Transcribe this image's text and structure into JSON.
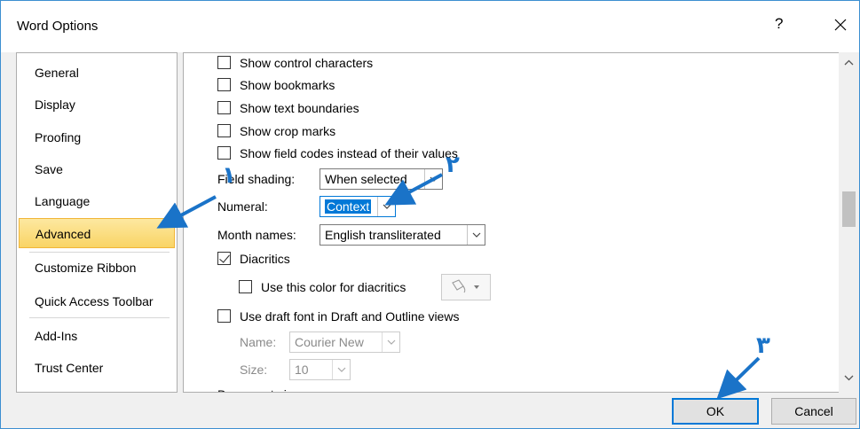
{
  "dialog": {
    "title": "Word Options",
    "help": "?",
    "ok_label": "OK",
    "cancel_label": "Cancel"
  },
  "sidebar": {
    "items": [
      {
        "label": "General"
      },
      {
        "label": "Display"
      },
      {
        "label": "Proofing"
      },
      {
        "label": "Save"
      },
      {
        "label": "Language"
      },
      {
        "label": "Advanced",
        "active": true
      },
      {
        "label": "Customize Ribbon"
      },
      {
        "label": "Quick Access Toolbar"
      },
      {
        "label": "Add-Ins"
      },
      {
        "label": "Trust Center"
      }
    ]
  },
  "content": {
    "checkboxes": [
      {
        "label": "Show control characters",
        "checked": false
      },
      {
        "label": "Show bookmarks",
        "checked": false
      },
      {
        "label": "Show text boundaries",
        "checked": false
      },
      {
        "label": "Show crop marks",
        "checked": false
      },
      {
        "label": "Show field codes instead of their values",
        "checked": false
      }
    ],
    "field_shading": {
      "label": "Field shading:",
      "value": "When selected"
    },
    "numeral": {
      "label": "Numeral:",
      "value": "Context"
    },
    "month_names": {
      "label": "Month names:",
      "value": "English transliterated"
    },
    "diacritics": {
      "label": "Diacritics",
      "checked": true
    },
    "diacritics_color": {
      "label": "Use this color for diacritics",
      "checked": false
    },
    "draft_font": {
      "label": "Use draft font in Draft and Outline views",
      "checked": false
    },
    "font_name": {
      "label": "Name:",
      "value": "Courier New"
    },
    "font_size": {
      "label": "Size:",
      "value": "10"
    },
    "cut_off_text": "Document view"
  },
  "annotations": {
    "color": "#1a73c8",
    "numbers": [
      "١",
      "٢",
      "٣"
    ]
  }
}
